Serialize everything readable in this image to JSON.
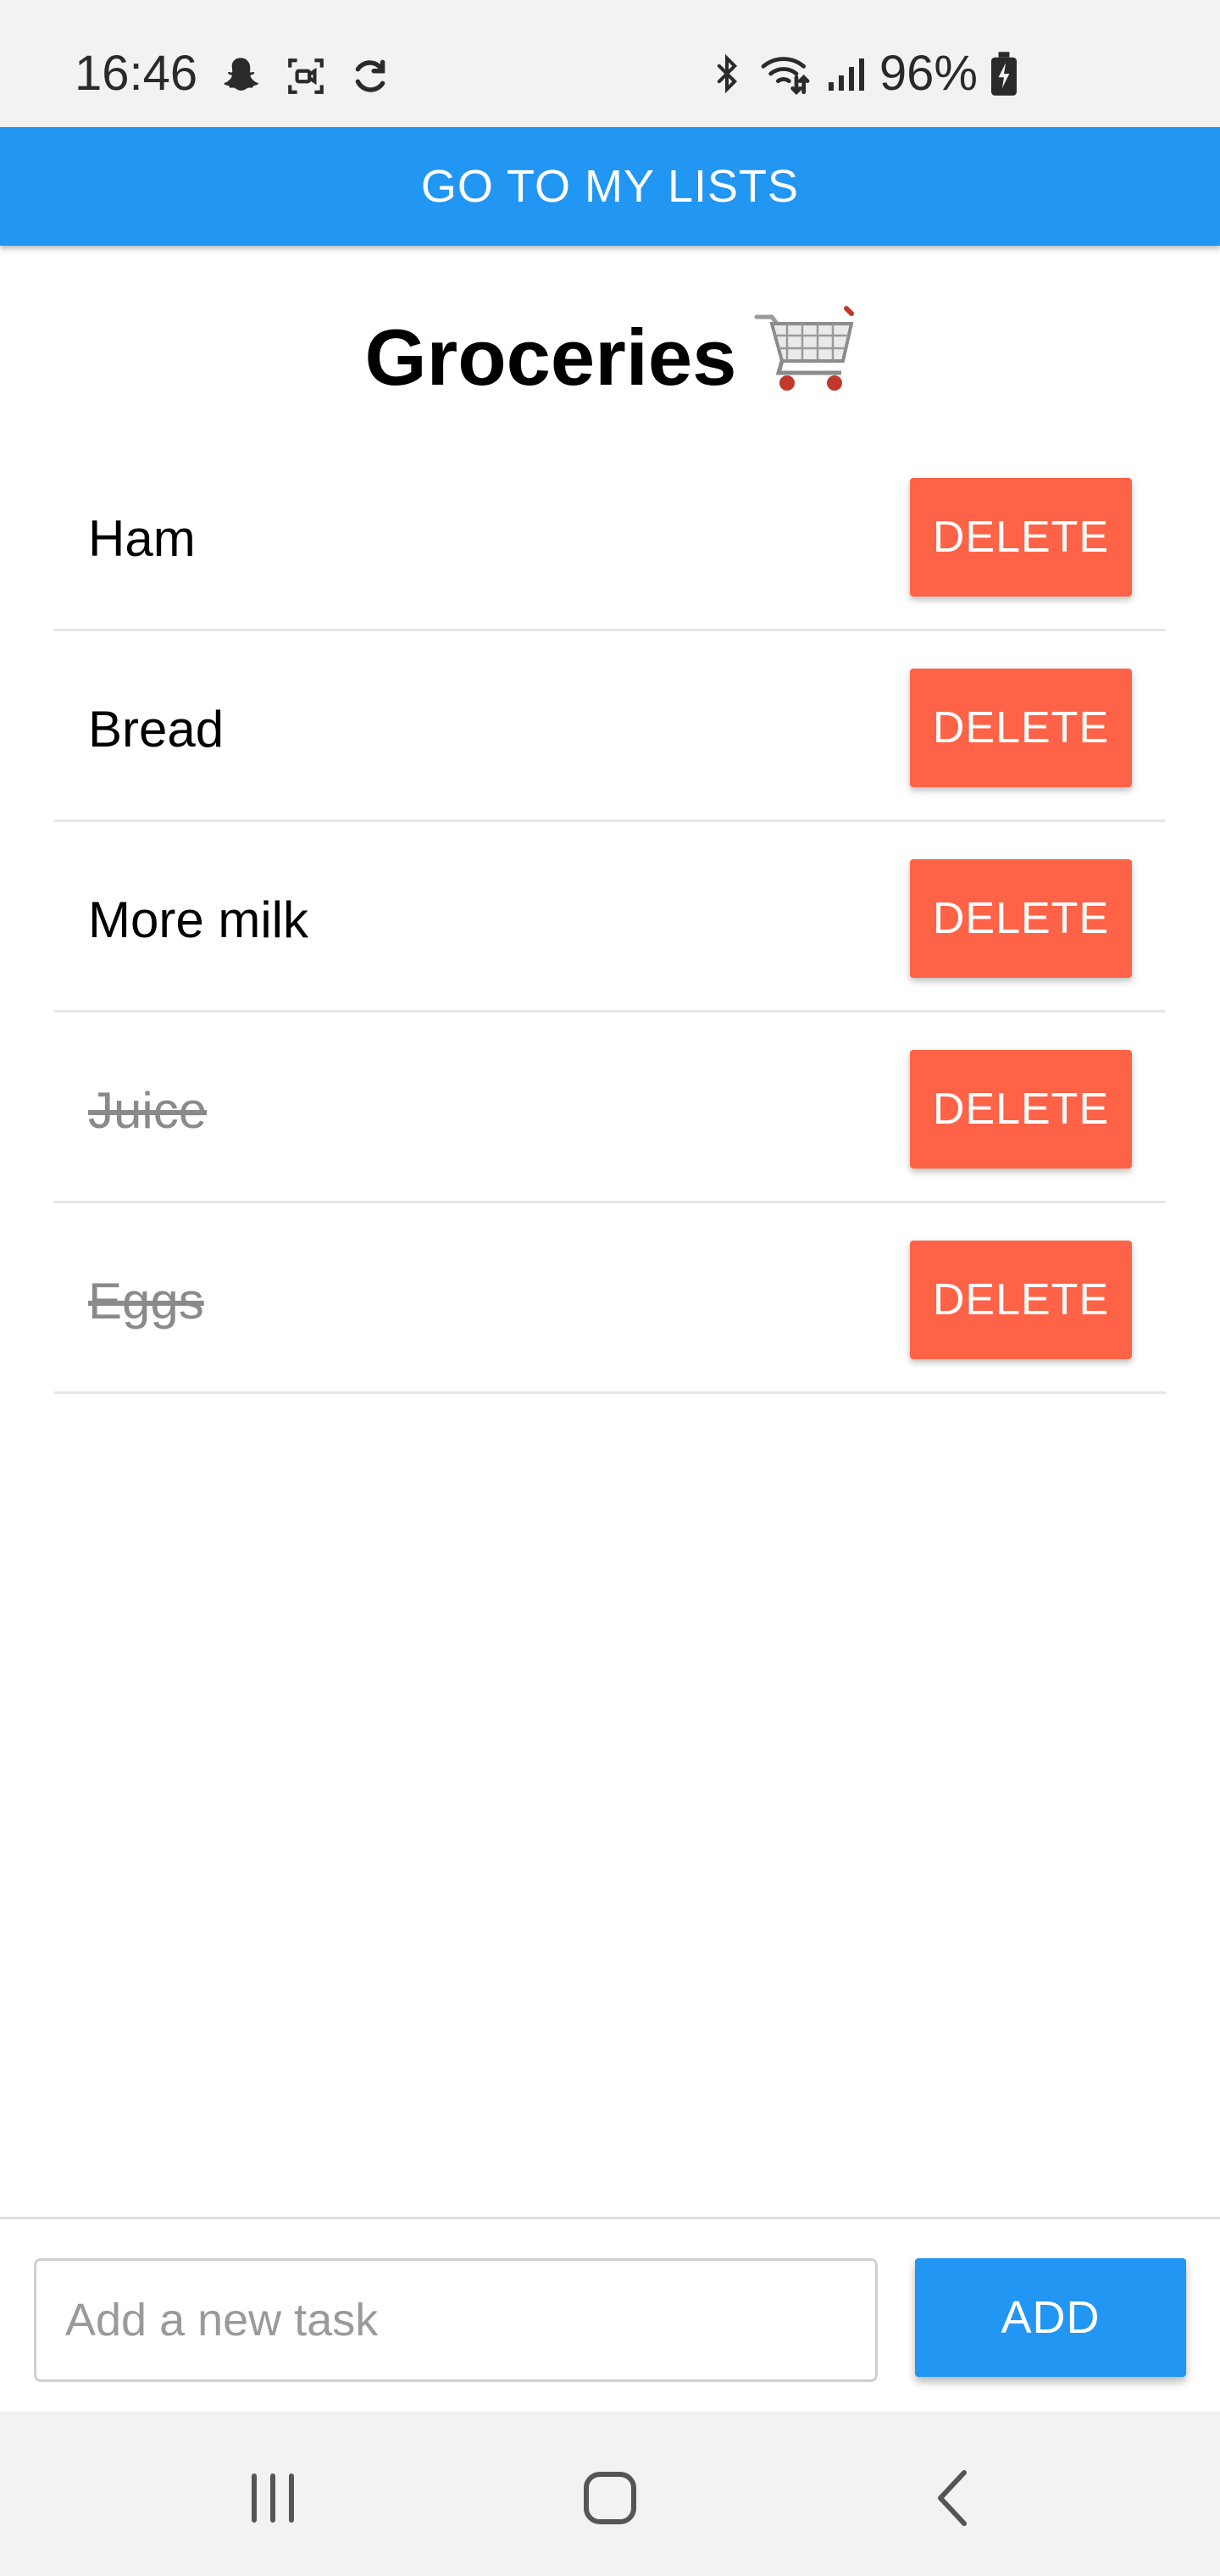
{
  "status_bar": {
    "time": "16:46",
    "battery": "96%",
    "left_icons": [
      "snapchat-icon",
      "screen-record-icon",
      "sync-icon"
    ],
    "right_icons": [
      "bluetooth-icon",
      "wifi-icon",
      "signal-icon",
      "battery-charging-icon"
    ]
  },
  "nav_button": {
    "label": "GO TO MY LISTS",
    "color": "#2196F3"
  },
  "title": {
    "text": "Groceries",
    "emoji": "shopping-cart-icon"
  },
  "tasks": [
    {
      "label": "Ham",
      "done": false,
      "delete_label": "DELETE"
    },
    {
      "label": "Bread",
      "done": false,
      "delete_label": "DELETE"
    },
    {
      "label": "More milk",
      "done": false,
      "delete_label": "DELETE"
    },
    {
      "label": "Juice",
      "done": true,
      "delete_label": "DELETE"
    },
    {
      "label": "Eggs",
      "done": true,
      "delete_label": "DELETE"
    }
  ],
  "delete_color": "#FF6347",
  "add_bar": {
    "input_placeholder": "Add a new task",
    "input_value": "",
    "add_label": "ADD"
  },
  "system_nav": [
    "recent-apps-icon",
    "home-icon",
    "back-icon"
  ]
}
